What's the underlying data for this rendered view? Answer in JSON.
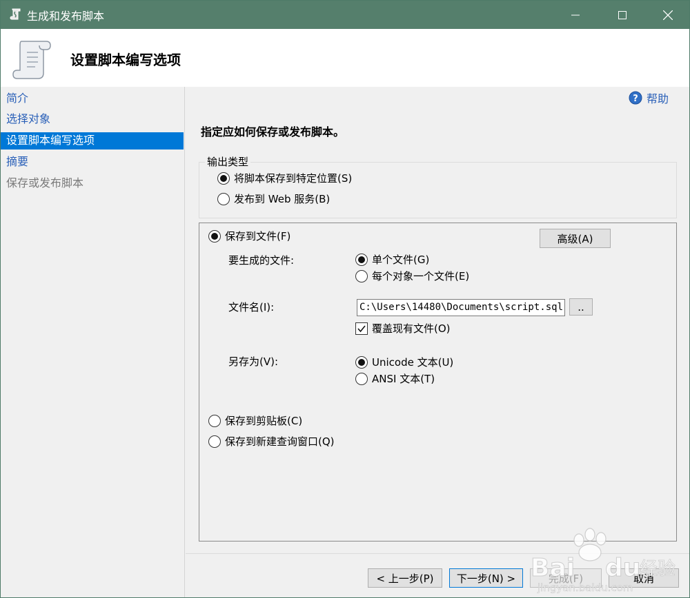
{
  "window": {
    "title": "生成和发布脚本"
  },
  "banner": {
    "title": "设置脚本编写选项"
  },
  "nav": {
    "items": [
      {
        "label": "简介",
        "state": "link"
      },
      {
        "label": "选择对象",
        "state": "link"
      },
      {
        "label": "设置脚本编写选项",
        "state": "active"
      },
      {
        "label": "摘要",
        "state": "link"
      },
      {
        "label": "保存或发布脚本",
        "state": "disabled"
      }
    ]
  },
  "help": {
    "label": "帮助"
  },
  "instruction": "指定应如何保存或发布脚本。",
  "output_type": {
    "legend": "输出类型",
    "options": [
      {
        "label": "将脚本保存到特定位置(S)",
        "selected": true
      },
      {
        "label": "发布到 Web 服务(B)",
        "selected": false
      }
    ]
  },
  "save": {
    "to_file": {
      "label": "保存到文件(F)",
      "selected": true
    },
    "advanced_button": "高级(A)",
    "files_label": "要生成的文件:",
    "files_options": [
      {
        "label": "单个文件(G)",
        "selected": true
      },
      {
        "label": "每个对象一个文件(E)",
        "selected": false
      }
    ],
    "filename_label": "文件名(I):",
    "filename_value": "C:\\Users\\14480\\Documents\\script.sql",
    "browse_button": "..",
    "overwrite": {
      "label": "覆盖现有文件(O)",
      "checked": true
    },
    "save_as_label": "另存为(V):",
    "save_as_options": [
      {
        "label": "Unicode 文本(U)",
        "selected": true
      },
      {
        "label": "ANSI 文本(T)",
        "selected": false
      }
    ],
    "to_clipboard": {
      "label": "保存到剪贴板(C)",
      "selected": false
    },
    "to_query_window": {
      "label": "保存到新建查询窗口(Q)",
      "selected": false
    }
  },
  "footer": {
    "back": "< 上一步(P)",
    "next": "下一步(N) >",
    "finish": "完成(F)",
    "cancel": "取消"
  },
  "watermark": {
    "text": "Baidu经验",
    "subtext": "jingyan.baidu.com"
  },
  "colors": {
    "titlebar": "#557f6c",
    "nav_active": "#0078d7",
    "link": "#2a60b8"
  }
}
